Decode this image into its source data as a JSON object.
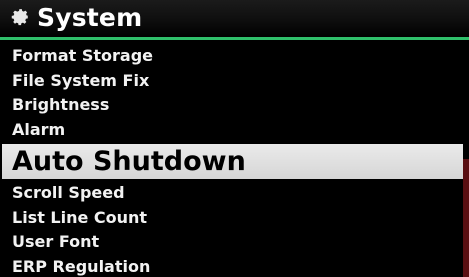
{
  "header": {
    "icon": "gear-icon",
    "title": "System"
  },
  "menu": {
    "items": [
      {
        "label": "Format Storage"
      },
      {
        "label": "File System Fix"
      },
      {
        "label": "Brightness"
      },
      {
        "label": "Alarm"
      },
      {
        "label": "Auto Shutdown",
        "selected": true
      },
      {
        "label": "Scroll Speed"
      },
      {
        "label": "List Line Count"
      },
      {
        "label": "User Font"
      },
      {
        "label": "ERP Regulation"
      }
    ]
  },
  "colors": {
    "accent": "#2fbf6a",
    "selection": "#d9d9d9",
    "scroll_indicator": "#5a0f12"
  }
}
